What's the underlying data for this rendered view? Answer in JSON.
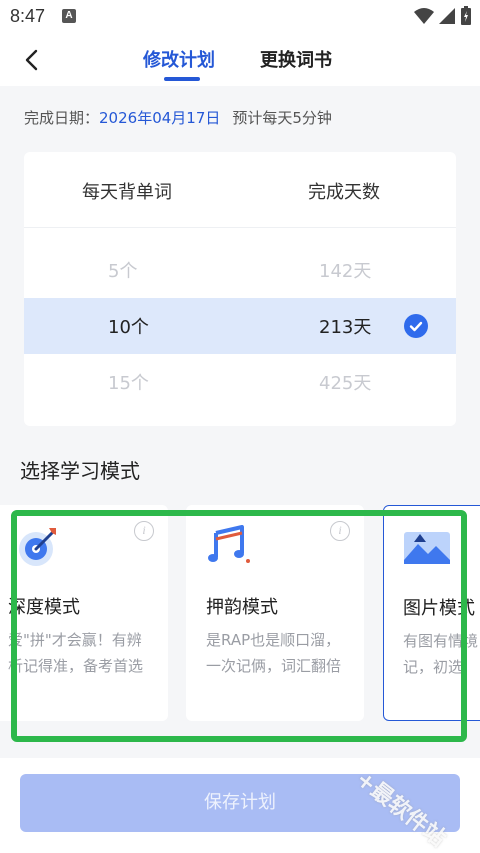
{
  "status": {
    "time": "8:47",
    "notif_letter": "A"
  },
  "nav": {
    "tab_edit": "修改计划",
    "tab_change": "更换词书"
  },
  "info": {
    "label": "完成日期：",
    "date": "2026年04月17日",
    "estimate": "预计每天5分钟"
  },
  "picker": {
    "col_left": "每天背单词",
    "col_right": "完成天数",
    "rows": [
      {
        "words": "5个",
        "days": "142天"
      },
      {
        "words": "10个",
        "days": "213天",
        "selected": true
      },
      {
        "words": "15个",
        "days": "425天"
      }
    ]
  },
  "modes": {
    "title": "选择学习模式",
    "items": [
      {
        "name": "深度模式",
        "desc": "爱\"拼\"才会赢！有辨析记得准，备考首选",
        "icon": "target-icon"
      },
      {
        "name": "押韵模式",
        "desc": "是RAP也是顺口溜，一次记俩，词汇翻倍",
        "icon": "music-note-icon"
      },
      {
        "name": "图片模式",
        "desc": "有图有情境，又好记，初选",
        "icon": "landscape-image-icon"
      }
    ]
  },
  "save_button": "保存计划",
  "watermark": "+最软件站",
  "colors": {
    "accent": "#2558d6",
    "highlight": "#2db84b",
    "selected_row": "#dde8fb",
    "save_disabled": "#a9bcf4"
  }
}
